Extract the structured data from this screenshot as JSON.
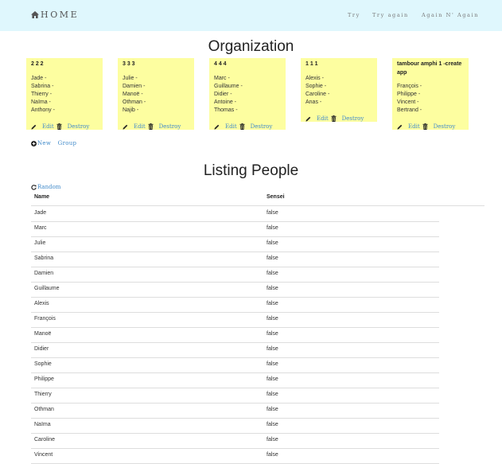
{
  "navbar": {
    "brand": "HOME",
    "links": [
      "Try",
      "Try again",
      "Again N' Again"
    ]
  },
  "organization": {
    "title": "Organization",
    "groups": [
      {
        "name": "2 2 2",
        "members": [
          "Jade -",
          "Sabrina -",
          "Thierry -",
          "Naïma -",
          "Anthony -"
        ],
        "edit": "Edit",
        "destroy": "Destroy"
      },
      {
        "name": "3 3 3",
        "members": [
          "Julie -",
          "Damien -",
          "Manoë -",
          "Othman -",
          "Najib -"
        ],
        "edit": "Edit",
        "destroy": "Destroy"
      },
      {
        "name": "4 4 4",
        "members": [
          "Marc -",
          "Guillaume -",
          "Didier -",
          "Antoine -",
          "Thomas -"
        ],
        "edit": "Edit",
        "destroy": "Destroy"
      },
      {
        "name": "1 1 1",
        "members": [
          "Alexis -",
          "Sophie -",
          "Caroline -",
          "Anas -"
        ],
        "edit": "Edit",
        "destroy": "Destroy"
      },
      {
        "name": "tambour amphi 1 -create app",
        "members": [
          "François -",
          "Philippe -",
          "Vincent -",
          "Bertrand -"
        ],
        "edit": "Edit",
        "destroy": "Destroy"
      }
    ],
    "new_group": "New Group"
  },
  "people": {
    "title": "Listing People",
    "random": "Random",
    "columns": [
      "Name",
      "Sensei"
    ],
    "rows": [
      [
        "Jade",
        "false"
      ],
      [
        "Marc",
        "false"
      ],
      [
        "Julie",
        "false"
      ],
      [
        "Sabrina",
        "false"
      ],
      [
        "Damien",
        "false"
      ],
      [
        "Guillaume",
        "false"
      ],
      [
        "Alexis",
        "false"
      ],
      [
        "François",
        "false"
      ],
      [
        "Manoë",
        "false"
      ],
      [
        "Didier",
        "false"
      ],
      [
        "Sophie",
        "false"
      ],
      [
        "Philippe",
        "false"
      ],
      [
        "Thierry",
        "false"
      ],
      [
        "Othman",
        "false"
      ],
      [
        "Naïma",
        "false"
      ],
      [
        "Caroline",
        "false"
      ],
      [
        "Vincent",
        "false"
      ]
    ]
  },
  "colors": {
    "navbar_bg": "#dff7fd",
    "note_bg": "#fdfea0",
    "link": "#428bca"
  }
}
